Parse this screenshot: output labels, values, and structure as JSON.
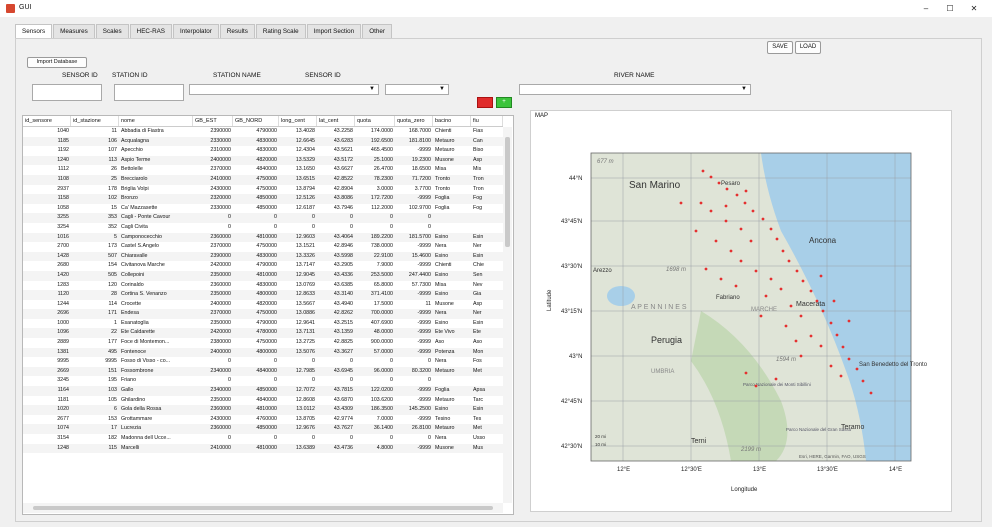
{
  "window": {
    "title": "GUI",
    "minimize": "–",
    "maximize": "☐",
    "close": "✕"
  },
  "tabs": [
    "Sensors",
    "Measures",
    "Scales",
    "HEC-RAS",
    "Interpolator",
    "Results",
    "Rating Scale",
    "Import Section",
    "Other"
  ],
  "buttons": {
    "save": "SAVE",
    "load": "LOAD",
    "import_db": "Import Database"
  },
  "labels": {
    "sensor_id": "SENSOR ID",
    "station_id": "STATION ID",
    "station_name": "STATION NAME",
    "sensor_id_dd": "SENSOR ID",
    "river_name": "RIVER NAME"
  },
  "colors": {
    "red_button": "#e02b2b",
    "green_button": "#3cc43c",
    "sensor_marker": "#e53030"
  },
  "table": {
    "columns": [
      "id_sensore",
      "id_stazione",
      "nome",
      "GB_EST",
      "GB_NORD",
      "long_cent",
      "lat_cent",
      "quota",
      "quota_zero",
      "bacino",
      "fiu"
    ],
    "rows": [
      [
        "1040",
        "11",
        "Abbadia di Fiastra",
        "2390000",
        "4790000",
        "13.4028",
        "43.2258",
        "174.0000",
        "168.7000",
        "Chienti",
        "Fias"
      ],
      [
        "1185",
        "106",
        "Acqualagna",
        "2330000",
        "4830000",
        "12.6645",
        "43.6283",
        "192.6500",
        "181.8100",
        "Metauro",
        "Can"
      ],
      [
        "1192",
        "107",
        "Apecchio",
        "2310000",
        "4830000",
        "12.4304",
        "43.5621",
        "465.4500",
        "-9999",
        "Metauro",
        "Biso"
      ],
      [
        "1240",
        "113",
        "Aspio Terme",
        "2400000",
        "4820000",
        "13.5329",
        "43.5172",
        "25.1000",
        "19.2300",
        "Musone",
        "Asp"
      ],
      [
        "1112",
        "26",
        "Bettolelle",
        "2370000",
        "4840000",
        "13.1650",
        "43.6627",
        "26.4700",
        "18.6500",
        "Misa",
        "Mis"
      ],
      [
        "1108",
        "25",
        "Brecciarolo",
        "2410000",
        "4750000",
        "13.6515",
        "42.8522",
        "78.2300",
        "71.7200",
        "Tronto",
        "Tron"
      ],
      [
        "2937",
        "178",
        "Briglia Volpi",
        "2430000",
        "4750000",
        "13.8794",
        "42.8904",
        "3.0000",
        "3.7700",
        "Tronto",
        "Tron"
      ],
      [
        "1158",
        "102",
        "Bronzo",
        "2320000",
        "4850000",
        "12.5126",
        "43.8086",
        "172.7200",
        "-9999",
        "Foglia",
        "Fog"
      ],
      [
        "1058",
        "15",
        "Ca' Mazzasette",
        "2330000",
        "4850000",
        "12.6187",
        "43.7946",
        "112.2000",
        "102.9700",
        "Foglia",
        "Fog"
      ],
      [
        "3255",
        "353",
        "Cagli - Ponte Cavour",
        "0",
        "0",
        "0",
        "0",
        "0",
        "0",
        "",
        ""
      ],
      [
        "3254",
        "352",
        "Cagli Civita",
        "0",
        "0",
        "0",
        "0",
        "0",
        "0",
        "",
        ""
      ],
      [
        "1016",
        "5",
        "Camponocecchio",
        "2360000",
        "4810000",
        "12.9603",
        "43.4064",
        "189.2200",
        "181.5700",
        "Esino",
        "Esin"
      ],
      [
        "2700",
        "173",
        "Castel S.Angelo",
        "2370000",
        "4750000",
        "13.1521",
        "42.8946",
        "738.0000",
        "-9999",
        "Nera",
        "Ner"
      ],
      [
        "1428",
        "507",
        "Chiaravalle",
        "2390000",
        "4830000",
        "13.3326",
        "43.5998",
        "22.9100",
        "15.4600",
        "Esino",
        "Esin"
      ],
      [
        "2680",
        "154",
        "Civitanova Marche",
        "2420000",
        "4790000",
        "13.7147",
        "43.2905",
        "7.9000",
        "-9999",
        "Chienti",
        "Chie"
      ],
      [
        "1420",
        "505",
        "Collepoini",
        "2350000",
        "4810000",
        "12.9045",
        "43.4336",
        "253.5000",
        "247.4400",
        "Esino",
        "Sen"
      ],
      [
        "1283",
        "120",
        "Corinaldo",
        "2360000",
        "4830000",
        "13.0769",
        "43.6385",
        "65.8000",
        "57.7300",
        "Misa",
        "Nev"
      ],
      [
        "1120",
        "28",
        "Cortina S. Venanzo",
        "2350000",
        "4800000",
        "12.8633",
        "43.3140",
        "371.4100",
        "-9999",
        "Esino",
        "Gia"
      ],
      [
        "1244",
        "114",
        "Crocette",
        "2400000",
        "4820000",
        "13.5667",
        "43.4940",
        "17.5000",
        "11",
        "Musone",
        "Asp"
      ],
      [
        "2696",
        "171",
        "Endesa",
        "2370000",
        "4750000",
        "13.0886",
        "42.8262",
        "700.0000",
        "-9999",
        "Nera",
        "Ner"
      ],
      [
        "1000",
        "1",
        "Esanatoglia",
        "2350000",
        "4790000",
        "12.9641",
        "43.2515",
        "407.6900",
        "-9999",
        "Esino",
        "Esin"
      ],
      [
        "1096",
        "22",
        "Ete Caldarette",
        "2420000",
        "4780000",
        "13.7131",
        "43.1359",
        "48.0000",
        "-9999",
        "Ete Vivo",
        "Ete"
      ],
      [
        "2889",
        "177",
        "Foce di Montemon...",
        "2380000",
        "4750000",
        "13.2725",
        "42.8825",
        "900.0000",
        "-9999",
        "Aso",
        "Aso"
      ],
      [
        "1381",
        "495",
        "Fontenoce",
        "2400000",
        "4800000",
        "13.5076",
        "43.3627",
        "57.0000",
        "-9999",
        "Potenza",
        "Mon"
      ],
      [
        "9995",
        "9995",
        "Fosso di Visso - co...",
        "0",
        "0",
        "0",
        "0",
        "0",
        "0",
        "Nera",
        "Fos"
      ],
      [
        "2669",
        "151",
        "Fossombrone",
        "2340000",
        "4840000",
        "12.7985",
        "43.6945",
        "96.0000",
        "80.3200",
        "Metauro",
        "Met"
      ],
      [
        "3245",
        "195",
        "Friano",
        "0",
        "0",
        "0",
        "0",
        "0",
        "0",
        "",
        ""
      ],
      [
        "1164",
        "103",
        "Gallo",
        "2340000",
        "4850000",
        "12.7072",
        "43.7815",
        "122.0200",
        "-9999",
        "Foglia",
        "Apsa"
      ],
      [
        "1181",
        "105",
        "Ghilardino",
        "2350000",
        "4840000",
        "12.8608",
        "43.6870",
        "103.6200",
        "-9999",
        "Metauro",
        "Tarc"
      ],
      [
        "1020",
        "6",
        "Gola della Rossa",
        "2360000",
        "4810000",
        "13.0112",
        "43.4309",
        "186.3500",
        "145.2500",
        "Esino",
        "Esin"
      ],
      [
        "2677",
        "153",
        "Grottammare",
        "2430000",
        "4760000",
        "13.8705",
        "42.9774",
        "7.0000",
        "-9999",
        "Tesino",
        "Tes"
      ],
      [
        "1074",
        "17",
        "Lucrezia",
        "2360000",
        "4850000",
        "12.9676",
        "43.7627",
        "36.1400",
        "26.8100",
        "Metauro",
        "Met"
      ],
      [
        "3154",
        "182",
        "Madonna dell Ucce...",
        "0",
        "0",
        "0",
        "0",
        "0",
        "0",
        "Nera",
        "Usso"
      ],
      [
        "1248",
        "115",
        "Marcelli",
        "2410000",
        "4810000",
        "13.6389",
        "43.4736",
        "4.8000",
        "-9999",
        "Musone",
        "Mus"
      ]
    ]
  },
  "map": {
    "label": "MAP",
    "y_axis": "Latitude",
    "x_axis": "Longitude",
    "lat_ticks": [
      "44°N",
      "43°45'N",
      "43°30'N",
      "43°15'N",
      "43°N",
      "42°45'N",
      "42°30'N"
    ],
    "lon_ticks": [
      "12°E",
      "12°30'E",
      "13°E",
      "13°30'E",
      "14°E"
    ],
    "places": [
      "San Marino",
      "Pesaro",
      "Ancona",
      "Fabriano",
      "Macerata",
      "Perugia",
      "San Benedetto del Tronto",
      "Teramo",
      "Terni",
      "UMBRIA",
      "MARCHE",
      "A P E N N I N E S",
      "Arezzo"
    ],
    "elevations": [
      "677 m",
      "1698 m",
      "1594 m",
      "2199 m"
    ],
    "park_labels": [
      "Parco Nazionale dei Monti Sibillini",
      "Parco Nazionale del Gran Sasso"
    ],
    "scale": [
      "20 mi",
      "10 mi"
    ],
    "attribution": "Esri, HERE, Garmin, FAO, USGS"
  }
}
